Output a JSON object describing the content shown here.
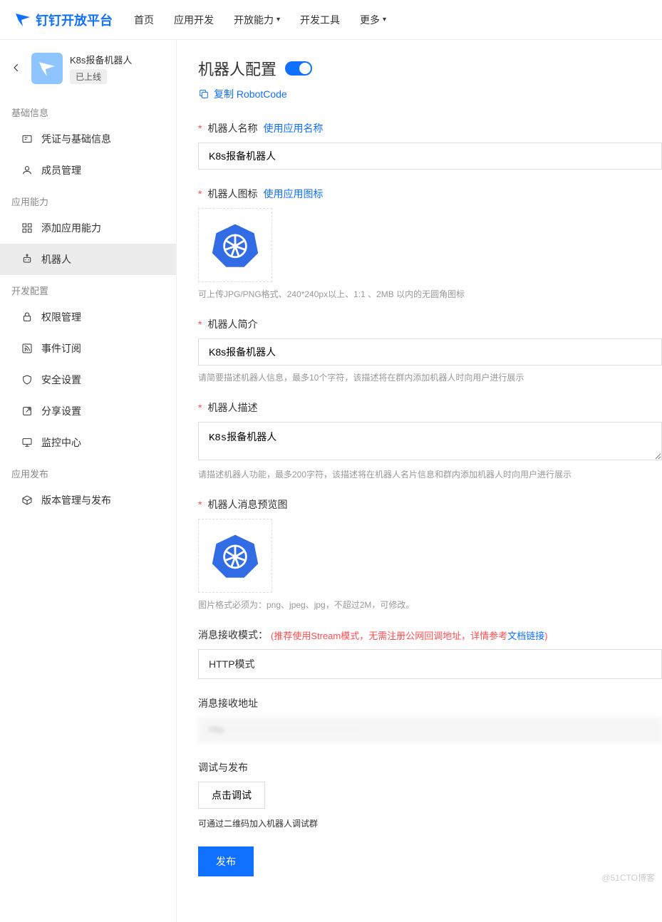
{
  "brand": "钉钉开放平台",
  "nav": {
    "home": "首页",
    "app_dev": "应用开发",
    "open_cap": "开放能力",
    "dev_tool": "开发工具",
    "more": "更多"
  },
  "app": {
    "name": "K8s报备机器人",
    "status": "已上线"
  },
  "sidebar": {
    "sec_basic": "基础信息",
    "cred": "凭证与基础信息",
    "member": "成员管理",
    "sec_cap": "应用能力",
    "add_cap": "添加应用能力",
    "robot": "机器人",
    "sec_dev": "开发配置",
    "perm": "权限管理",
    "event": "事件订阅",
    "security": "安全设置",
    "share": "分享设置",
    "monitor": "监控中心",
    "sec_pub": "应用发布",
    "version": "版本管理与发布"
  },
  "page": {
    "title": "机器人配置",
    "copy_code": "复制 RobotCode",
    "name_label": "机器人名称",
    "use_app_name": "使用应用名称",
    "name_value": "K8s报备机器人",
    "icon_label": "机器人图标",
    "use_app_icon": "使用应用图标",
    "icon_hint": "可上传JPG/PNG格式、240*240px以上、1:1 、2MB 以内的无圆角图标",
    "intro_label": "机器人简介",
    "intro_value": "K8s报备机器人",
    "intro_hint": "请简要描述机器人信息，最多10个字符，该描述将在群内添加机器人时向用户进行展示",
    "desc_label": "机器人描述",
    "desc_value": "K8s报备机器人",
    "desc_hint": "请描述机器人功能，最多200字符，该描述将在机器人名片信息和群内添加机器人时向用户进行展示",
    "preview_label": "机器人消息预览图",
    "preview_hint": "图片格式必须为：png、jpeg、jpg，不超过2M，可修改。",
    "mode_label": "消息接收模式：",
    "mode_hint_prefix": "(推荐使用Stream模式，无需注册公网回调地址，详情参考",
    "mode_hint_link": "文档链接",
    "mode_hint_suffix": ")",
    "mode_value": "HTTP模式",
    "addr_label": "消息接收地址",
    "debug_label": "调试与发布",
    "debug_btn": "点击调试",
    "debug_hint": "可通过二维码加入机器人调试群",
    "publish_btn": "发布"
  },
  "watermark": "@51CTO博客"
}
